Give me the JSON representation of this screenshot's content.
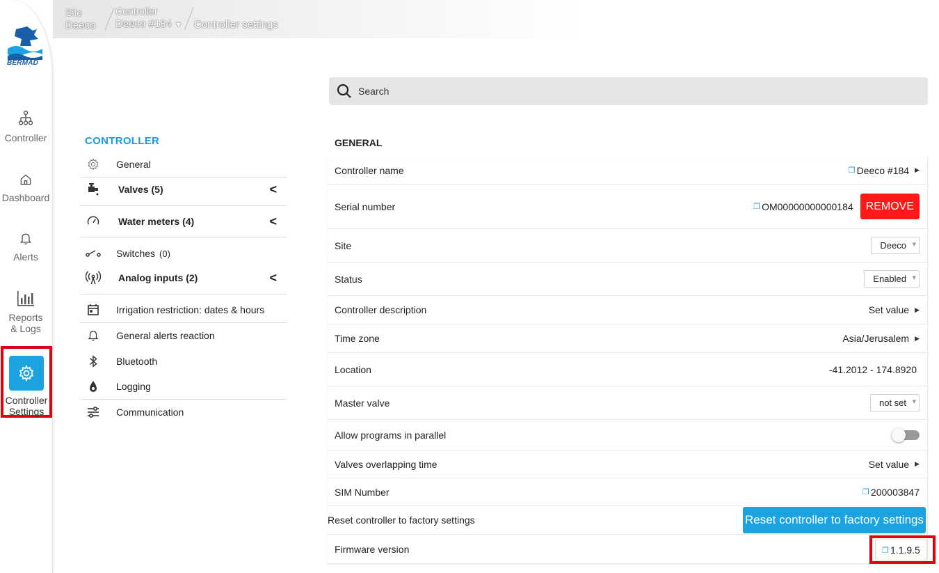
{
  "brand": {
    "logo_text": "BERMAD"
  },
  "nav": {
    "items": [
      {
        "label": "Controller"
      },
      {
        "label": "Dashboard"
      },
      {
        "label": "Alerts"
      },
      {
        "label": "Reports & Logs"
      },
      {
        "label": "Controller Settings",
        "active": true
      }
    ]
  },
  "breadcrumb": {
    "site_label": "Site",
    "site_value": "Deeco",
    "controller_label": "Controller",
    "controller_value": "Deeco #184",
    "page": "Controller settings"
  },
  "menu": {
    "title": "CONTROLLER",
    "items": [
      {
        "label": "General",
        "icon": "gear-icon"
      },
      {
        "label": "Valves (5)",
        "icon": "valve-icon",
        "expandable": true
      },
      {
        "label": "Water meters (4)",
        "icon": "gauge-icon",
        "expandable": true
      },
      {
        "label": "Switches",
        "count": "(0)",
        "icon": "switch-icon"
      },
      {
        "label": "Analog inputs (2)",
        "icon": "antenna-icon",
        "expandable": true
      },
      {
        "label": "Irrigation restriction: dates & hours",
        "icon": "calendar-icon"
      },
      {
        "label": "General alerts reaction",
        "icon": "bell-icon"
      },
      {
        "label": "Bluetooth",
        "icon": "bluetooth-icon"
      },
      {
        "label": "Logging",
        "icon": "drop-icon"
      },
      {
        "label": "Communication",
        "icon": "sliders-icon"
      }
    ]
  },
  "search": {
    "placeholder": "Search"
  },
  "general": {
    "title": "GENERAL",
    "controller_name": {
      "label": "Controller name",
      "value": "Deeco #184"
    },
    "serial_number": {
      "label": "Serial number",
      "value": "OM00000000000184",
      "remove_label": "REMOVE"
    },
    "site": {
      "label": "Site",
      "value": "Deeco"
    },
    "status": {
      "label": "Status",
      "value": "Enabled"
    },
    "description": {
      "label": "Controller description",
      "value": "Set value"
    },
    "time_zone": {
      "label": "Time zone",
      "value": "Asia/Jerusalem"
    },
    "location": {
      "label": "Location",
      "value": "-41.2012 - 174.8920"
    },
    "master_valve": {
      "label": "Master valve",
      "value": "not set"
    },
    "parallel": {
      "label": "Allow programs in parallel",
      "enabled": false
    },
    "overlap": {
      "label": "Valves overlapping time",
      "value": "Set value"
    },
    "sim": {
      "label": "SIM Number",
      "value": "200003847"
    },
    "reset": {
      "label": "Reset controller to factory settings",
      "button": "Reset controller to factory settings"
    },
    "firmware": {
      "label": "Firmware version",
      "value": "1.1.9.5"
    }
  },
  "colors": {
    "accent": "#1aa3e0",
    "danger": "#ff1a1a",
    "highlight": "#e3000f"
  }
}
